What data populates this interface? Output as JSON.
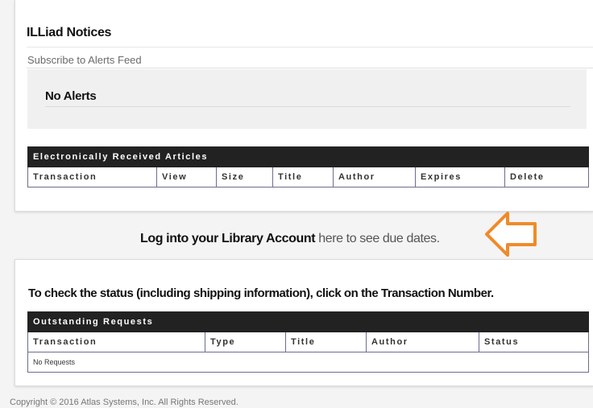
{
  "notices": {
    "title": "ILLiad Notices",
    "feed_link": "Subscribe to Alerts Feed",
    "no_alerts": "No Alerts"
  },
  "electronic_articles": {
    "caption": "Electronically Received Articles",
    "columns": [
      "Transaction",
      "View",
      "Size",
      "Title",
      "Author",
      "Expires",
      "Delete"
    ]
  },
  "login": {
    "bold_text": "Log into your Library Account",
    "link_text": "here to see due dates."
  },
  "arrow": {
    "icon": "left-arrow-outline-icon",
    "color": "#f08a2a"
  },
  "status": {
    "instruction": "To check the status (including shipping information), click on the Transaction Number."
  },
  "outstanding_requests": {
    "caption": "Outstanding Requests",
    "columns": [
      "Transaction",
      "Type",
      "Title",
      "Author",
      "Status"
    ],
    "empty_message": "No Requests"
  },
  "footer": {
    "copyright": "Copyright © 2016 Atlas Systems, Inc. All Rights Reserved."
  },
  "colors": {
    "header_bg": "#222222",
    "table_border": "#6d6d8f",
    "arrow": "#f08a2a"
  }
}
